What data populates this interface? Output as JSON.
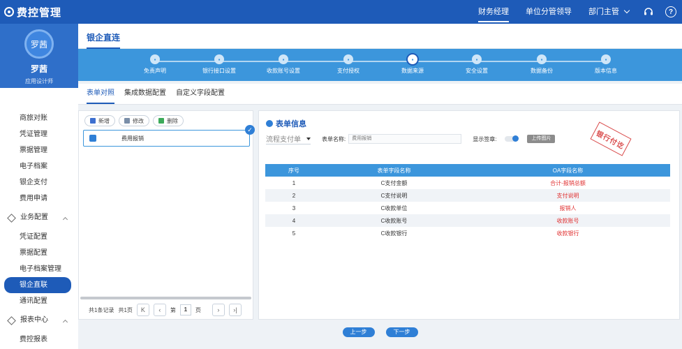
{
  "app": {
    "title": "费控管理"
  },
  "topnav": {
    "items": [
      "财务经理",
      "单位分管领导",
      "部门主管"
    ]
  },
  "help_symbol": "?",
  "user": {
    "avatar_text": "罗茜",
    "name": "罗茜",
    "role": "应用设计师"
  },
  "sidebar": {
    "items_top": [
      "商旅对账",
      "凭证管理",
      "票据管理",
      "电子档案",
      "银企支付",
      "费用申请"
    ],
    "group1": "业务配置",
    "items_mid": [
      "凭证配置",
      "票据配置",
      "电子档案管理",
      "银企直联",
      "通讯配置"
    ],
    "group2": "报表中心",
    "items_bottom": [
      "费控报表"
    ]
  },
  "main_tab": "银企直连",
  "steps": [
    "免责声明",
    "银行接口设置",
    "收款账号设置",
    "支付授权",
    "数据来源",
    "安全设置",
    "数据备份",
    "版本信息"
  ],
  "active_step_index": 4,
  "subtabs": [
    "表单对照",
    "集成数据配置",
    "自定义字段配置"
  ],
  "left_panel": {
    "buttons": {
      "add": "新增",
      "edit": "修改",
      "delete": "删除"
    },
    "list_item": "费用报销",
    "check": "✓",
    "pager": {
      "total_records": "共1条记录",
      "total_pages": "共1页",
      "page_prefix": "第",
      "page_value": "1",
      "page_suffix": "页",
      "first": "K",
      "prev": "‹",
      "next": "›",
      "last": "›|"
    }
  },
  "right_panel": {
    "title": "表单信息",
    "process_select": "流程支付单",
    "form_name_label": "表单名称:",
    "form_name_value": "费用报销",
    "show_sign_label": "显示签章:",
    "upload_label": "上传图片",
    "seal_text": "银行付讫",
    "table": {
      "headers": [
        "序号",
        "表单字段名称",
        "OA字段名称"
      ],
      "rows": [
        [
          "1",
          "C支付金额",
          "合计-报销总额"
        ],
        [
          "2",
          "C支付说明",
          "支付说明"
        ],
        [
          "3",
          "C收款单位",
          "报销人"
        ],
        [
          "4",
          "C收款账号",
          "收款账号"
        ],
        [
          "5",
          "C收款银行",
          "收款银行"
        ]
      ]
    }
  },
  "footer": {
    "prev": "上一步",
    "next": "下一步"
  },
  "colors": {
    "primary": "#1e5bb8",
    "step_bar": "#3c96dc",
    "red": "#e03030"
  }
}
